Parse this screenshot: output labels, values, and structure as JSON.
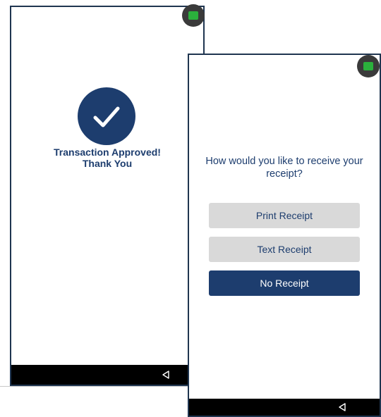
{
  "approval_screen": {
    "line1": "Transaction Approved!",
    "line2": "Thank You"
  },
  "receipt_screen": {
    "prompt": "How would you like to receive your receipt?",
    "buttons": {
      "print": "Print Receipt",
      "text": "Text Receipt",
      "none": "No Receipt"
    }
  },
  "colors": {
    "brand_navy": "#1d3d6e",
    "button_grey": "#d9d9d9",
    "status_green": "#2bb03c",
    "nav_bar": "#000000"
  },
  "icons": {
    "approved": "checkmark-icon",
    "status": "status-indicator-icon",
    "nav_back": "back-triangle-icon"
  }
}
